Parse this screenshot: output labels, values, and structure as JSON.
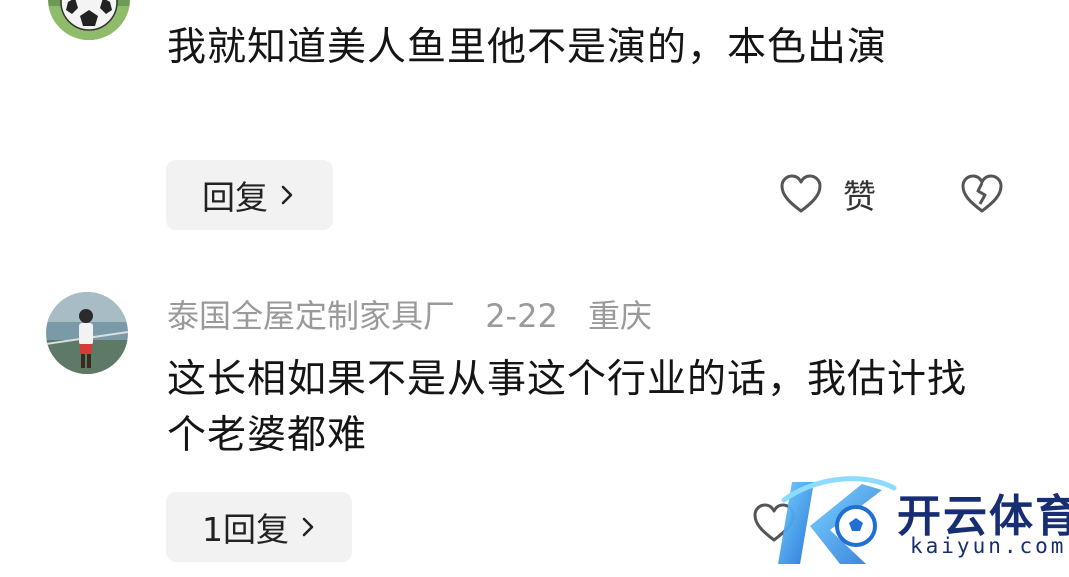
{
  "comments": [
    {
      "text": "我就知道美人鱼里他不是演的，本色出演",
      "reply_label": "回复",
      "like_label": "赞"
    },
    {
      "username": "泰国全屋定制家具厂",
      "date": "2-22",
      "location": "重庆",
      "text": "这长相如果不是从事这个行业的话，我估计找个老婆都难",
      "reply_label": "1回复"
    }
  ],
  "watermark": {
    "name_cn": "开云体育",
    "name_en": "kaiyun.com"
  },
  "icons": {
    "reply_chevron": "chevron-right-icon",
    "like": "heart-outline-icon",
    "dislike": "broken-heart-icon"
  },
  "colors": {
    "text_primary": "#151515",
    "text_meta": "#9a9a9a",
    "reply_bg": "#f2f2f2",
    "watermark_navy": "#172e73",
    "watermark_blue": "#2b9bf0"
  }
}
